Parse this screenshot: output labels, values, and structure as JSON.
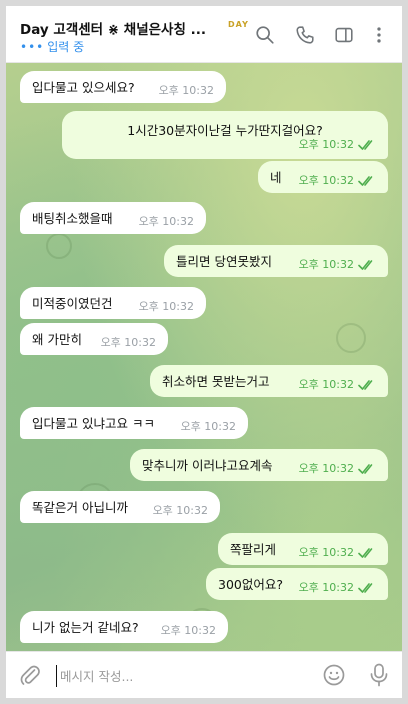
{
  "header": {
    "title": "Day 고객센터 ⋇ 채널은사칭 ...",
    "badge": "DAY",
    "status_dots": "•••",
    "status": "입력 중",
    "icons": [
      "search-icon",
      "phone-icon",
      "sidebar-toggle-icon",
      "more-vert-icon"
    ]
  },
  "messages": [
    {
      "dir": "in",
      "text": "입다물고 있으세요?",
      "time": "오후 10:32"
    },
    {
      "dir": "out",
      "text": "1시간30분자이난걸 누가딴지걸어요?",
      "time": "오후 10:32"
    },
    {
      "dir": "out",
      "text": "네",
      "time": "오후 10:32"
    },
    {
      "dir": "in",
      "text": "배팅취소했을때",
      "time": "오후 10:32"
    },
    {
      "dir": "out",
      "text": "틀리면 당연못봤지",
      "time": "오후 10:32"
    },
    {
      "dir": "in",
      "text": "미적중이였던건",
      "time": "오후 10:32"
    },
    {
      "dir": "in",
      "text": "왜 가만히",
      "time": "오후 10:32"
    },
    {
      "dir": "out",
      "text": "취소하면 못받는거고",
      "time": "오후 10:32"
    },
    {
      "dir": "in",
      "text": "입다물고 있냐고요 ㅋㅋ",
      "time": "오후 10:32"
    },
    {
      "dir": "out",
      "text": "맞추니까 이러냐고요계속",
      "time": "오후 10:32"
    },
    {
      "dir": "in",
      "text": "똑같은거 아닙니까",
      "time": "오후 10:32"
    },
    {
      "dir": "out",
      "text": "쪽팔리게",
      "time": "오후 10:32"
    },
    {
      "dir": "out",
      "text": "300없어요?",
      "time": "오후 10:32"
    },
    {
      "dir": "in",
      "text": "니가 없는거 같네요?",
      "time": "오후 10:32"
    }
  ],
  "input": {
    "placeholder": "메시지 작성...",
    "value": ""
  },
  "colors": {
    "incoming_bubble": "#ffffff",
    "outgoing_bubble": "#effdde",
    "outgoing_time": "#4fae4e",
    "accent": "#3390ec"
  }
}
